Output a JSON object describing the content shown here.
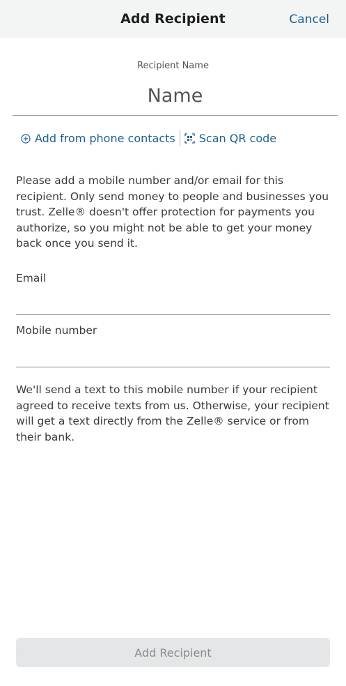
{
  "header": {
    "title": "Add Recipient",
    "cancel_label": "Cancel"
  },
  "recipient": {
    "name_label": "Recipient Name",
    "name_placeholder": "Name"
  },
  "links": {
    "add_contacts_label": "Add from phone contacts",
    "scan_qr_label": "Scan QR code"
  },
  "notice": "Please add a mobile number and/or email for this recipient. Only send money to people and businesses you trust. Zelle® doesn't offer protection for payments you authorize, so you might not be able to get your money back once you send it.",
  "email": {
    "label": "Email",
    "value": ""
  },
  "mobile": {
    "label": "Mobile number",
    "value": ""
  },
  "sms_note": "We'll send a text to this mobile number if your recipient agreed to receive texts from us. Otherwise, your recipient will get a text directly from the Zelle® service or from their bank.",
  "footer": {
    "add_button_label": "Add Recipient",
    "add_button_enabled": false
  },
  "colors": {
    "link": "#1d5f8f",
    "header_bg": "#f3f4f4",
    "button_disabled_bg": "#e5e6e7",
    "button_disabled_text": "#8c8c8c"
  },
  "icons": {
    "add_contacts": "plus-circle-icon",
    "scan_qr": "qr-scan-icon"
  }
}
